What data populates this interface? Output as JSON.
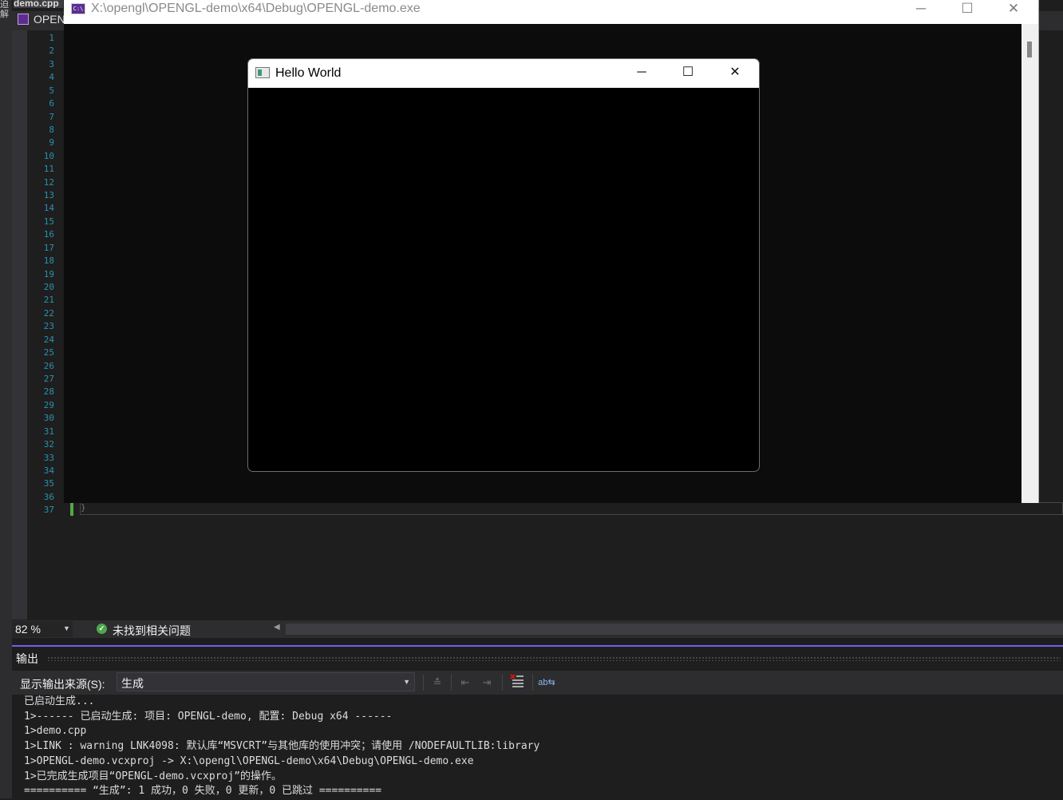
{
  "vs": {
    "document_tab": "demo.cpp",
    "left_strip_chars": "迫\n解",
    "project_nav": "OPENGL-demo",
    "line_numbers": [
      "1",
      "2",
      "3",
      "4",
      "5",
      "6",
      "7",
      "8",
      "9",
      "10",
      "11",
      "12",
      "13",
      "14",
      "15",
      "16",
      "17",
      "18",
      "19",
      "20",
      "21",
      "22",
      "23",
      "24",
      "25",
      "26",
      "27",
      "28",
      "29",
      "30",
      "31",
      "32",
      "33",
      "34",
      "35",
      "36",
      "37"
    ],
    "code_last_line": "}",
    "status": {
      "zoom": "82 %",
      "issues": "未找到相关问题"
    },
    "output": {
      "title": "输出",
      "source_label": "显示输出来源(S):",
      "source_value": "生成",
      "lines": [
        "已启动生成...",
        "1>------ 已启动生成: 项目: OPENGL-demo, 配置: Debug x64 ------",
        "1>demo.cpp",
        "1>LINK : warning LNK4098: 默认库“MSVCRT”与其他库的使用冲突；请使用 /NODEFAULTLIB:library",
        "1>OPENGL-demo.vcxproj -> X:\\opengl\\OPENGL-demo\\x64\\Debug\\OPENGL-demo.exe",
        "1>已完成生成项目“OPENGL-demo.vcxproj”的操作。",
        "========== “生成”: 1 成功，0 失败，0 更新，0 已跳过 =========="
      ]
    }
  },
  "console": {
    "title": "X:\\opengl\\OPENGL-demo\\x64\\Debug\\OPENGL-demo.exe",
    "icon_text": "C:\\"
  },
  "hello": {
    "title": "Hello World"
  },
  "colors": {
    "accent": "#7160e8",
    "line_number": "#2b91af",
    "change_bar": "#57a64a"
  }
}
